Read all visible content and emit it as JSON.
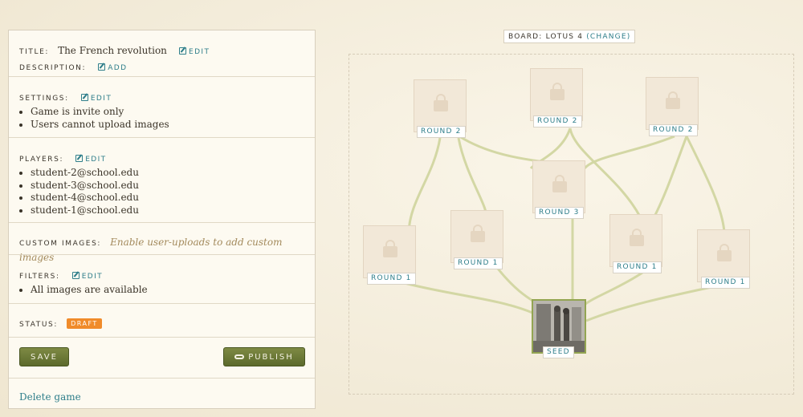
{
  "game": {
    "title_label": "TITLE:",
    "title_value": "The French revolution",
    "title_edit": "EDIT",
    "description_label": "DESCRIPTION:",
    "description_add": "ADD"
  },
  "settings": {
    "label": "SETTINGS:",
    "edit": "EDIT",
    "items": [
      "Game is invite only",
      "Users cannot upload images"
    ]
  },
  "players": {
    "label": "PLAYERS:",
    "edit": "EDIT",
    "items": [
      "student-2@school.edu",
      "student-3@school.edu",
      "student-4@school.edu",
      "student-1@school.edu"
    ]
  },
  "custom_images": {
    "label": "CUSTOM IMAGES:",
    "hint": "Enable user-uploads to add custom images"
  },
  "filters": {
    "label": "FILTERS:",
    "edit": "EDIT",
    "items": [
      "All images are available"
    ]
  },
  "status": {
    "label": "STATUS:",
    "badge": "DRAFT",
    "badge_color": "#f08b2a"
  },
  "actions": {
    "save": "SAVE",
    "publish": "PUBLISH",
    "delete": "Delete game"
  },
  "board": {
    "label": "BOARD: LOTUS 4",
    "change": "(CHANGE)",
    "nodes": {
      "r2a": "ROUND 2",
      "r2b": "ROUND 2",
      "r2c": "ROUND 2",
      "r3": "ROUND 3",
      "r1a": "ROUND 1",
      "r1b": "ROUND 1",
      "r1c": "ROUND 1",
      "r1d": "ROUND 1",
      "seed": "SEED"
    }
  },
  "colors": {
    "accent_link": "#2e7e8a",
    "button_green": "#6b7a35",
    "connector": "#d3d7a4"
  }
}
